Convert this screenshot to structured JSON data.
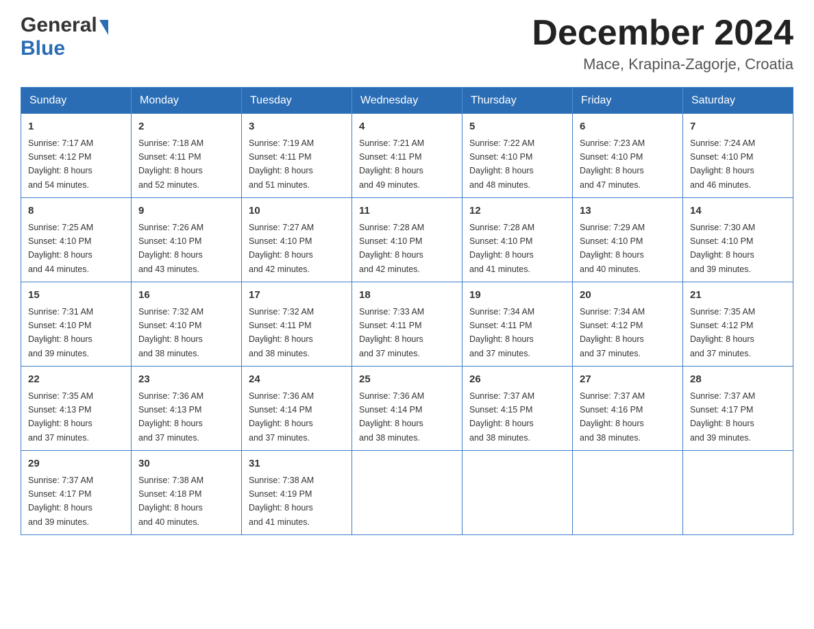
{
  "header": {
    "logo_general": "General",
    "logo_blue": "Blue",
    "main_title": "December 2024",
    "subtitle": "Mace, Krapina-Zagorje, Croatia"
  },
  "calendar": {
    "days_of_week": [
      "Sunday",
      "Monday",
      "Tuesday",
      "Wednesday",
      "Thursday",
      "Friday",
      "Saturday"
    ],
    "weeks": [
      [
        {
          "day": "1",
          "sunrise": "Sunrise: 7:17 AM",
          "sunset": "Sunset: 4:12 PM",
          "daylight": "Daylight: 8 hours",
          "minutes": "and 54 minutes."
        },
        {
          "day": "2",
          "sunrise": "Sunrise: 7:18 AM",
          "sunset": "Sunset: 4:11 PM",
          "daylight": "Daylight: 8 hours",
          "minutes": "and 52 minutes."
        },
        {
          "day": "3",
          "sunrise": "Sunrise: 7:19 AM",
          "sunset": "Sunset: 4:11 PM",
          "daylight": "Daylight: 8 hours",
          "minutes": "and 51 minutes."
        },
        {
          "day": "4",
          "sunrise": "Sunrise: 7:21 AM",
          "sunset": "Sunset: 4:11 PM",
          "daylight": "Daylight: 8 hours",
          "minutes": "and 49 minutes."
        },
        {
          "day": "5",
          "sunrise": "Sunrise: 7:22 AM",
          "sunset": "Sunset: 4:10 PM",
          "daylight": "Daylight: 8 hours",
          "minutes": "and 48 minutes."
        },
        {
          "day": "6",
          "sunrise": "Sunrise: 7:23 AM",
          "sunset": "Sunset: 4:10 PM",
          "daylight": "Daylight: 8 hours",
          "minutes": "and 47 minutes."
        },
        {
          "day": "7",
          "sunrise": "Sunrise: 7:24 AM",
          "sunset": "Sunset: 4:10 PM",
          "daylight": "Daylight: 8 hours",
          "minutes": "and 46 minutes."
        }
      ],
      [
        {
          "day": "8",
          "sunrise": "Sunrise: 7:25 AM",
          "sunset": "Sunset: 4:10 PM",
          "daylight": "Daylight: 8 hours",
          "minutes": "and 44 minutes."
        },
        {
          "day": "9",
          "sunrise": "Sunrise: 7:26 AM",
          "sunset": "Sunset: 4:10 PM",
          "daylight": "Daylight: 8 hours",
          "minutes": "and 43 minutes."
        },
        {
          "day": "10",
          "sunrise": "Sunrise: 7:27 AM",
          "sunset": "Sunset: 4:10 PM",
          "daylight": "Daylight: 8 hours",
          "minutes": "and 42 minutes."
        },
        {
          "day": "11",
          "sunrise": "Sunrise: 7:28 AM",
          "sunset": "Sunset: 4:10 PM",
          "daylight": "Daylight: 8 hours",
          "minutes": "and 42 minutes."
        },
        {
          "day": "12",
          "sunrise": "Sunrise: 7:28 AM",
          "sunset": "Sunset: 4:10 PM",
          "daylight": "Daylight: 8 hours",
          "minutes": "and 41 minutes."
        },
        {
          "day": "13",
          "sunrise": "Sunrise: 7:29 AM",
          "sunset": "Sunset: 4:10 PM",
          "daylight": "Daylight: 8 hours",
          "minutes": "and 40 minutes."
        },
        {
          "day": "14",
          "sunrise": "Sunrise: 7:30 AM",
          "sunset": "Sunset: 4:10 PM",
          "daylight": "Daylight: 8 hours",
          "minutes": "and 39 minutes."
        }
      ],
      [
        {
          "day": "15",
          "sunrise": "Sunrise: 7:31 AM",
          "sunset": "Sunset: 4:10 PM",
          "daylight": "Daylight: 8 hours",
          "minutes": "and 39 minutes."
        },
        {
          "day": "16",
          "sunrise": "Sunrise: 7:32 AM",
          "sunset": "Sunset: 4:10 PM",
          "daylight": "Daylight: 8 hours",
          "minutes": "and 38 minutes."
        },
        {
          "day": "17",
          "sunrise": "Sunrise: 7:32 AM",
          "sunset": "Sunset: 4:11 PM",
          "daylight": "Daylight: 8 hours",
          "minutes": "and 38 minutes."
        },
        {
          "day": "18",
          "sunrise": "Sunrise: 7:33 AM",
          "sunset": "Sunset: 4:11 PM",
          "daylight": "Daylight: 8 hours",
          "minutes": "and 37 minutes."
        },
        {
          "day": "19",
          "sunrise": "Sunrise: 7:34 AM",
          "sunset": "Sunset: 4:11 PM",
          "daylight": "Daylight: 8 hours",
          "minutes": "and 37 minutes."
        },
        {
          "day": "20",
          "sunrise": "Sunrise: 7:34 AM",
          "sunset": "Sunset: 4:12 PM",
          "daylight": "Daylight: 8 hours",
          "minutes": "and 37 minutes."
        },
        {
          "day": "21",
          "sunrise": "Sunrise: 7:35 AM",
          "sunset": "Sunset: 4:12 PM",
          "daylight": "Daylight: 8 hours",
          "minutes": "and 37 minutes."
        }
      ],
      [
        {
          "day": "22",
          "sunrise": "Sunrise: 7:35 AM",
          "sunset": "Sunset: 4:13 PM",
          "daylight": "Daylight: 8 hours",
          "minutes": "and 37 minutes."
        },
        {
          "day": "23",
          "sunrise": "Sunrise: 7:36 AM",
          "sunset": "Sunset: 4:13 PM",
          "daylight": "Daylight: 8 hours",
          "minutes": "and 37 minutes."
        },
        {
          "day": "24",
          "sunrise": "Sunrise: 7:36 AM",
          "sunset": "Sunset: 4:14 PM",
          "daylight": "Daylight: 8 hours",
          "minutes": "and 37 minutes."
        },
        {
          "day": "25",
          "sunrise": "Sunrise: 7:36 AM",
          "sunset": "Sunset: 4:14 PM",
          "daylight": "Daylight: 8 hours",
          "minutes": "and 38 minutes."
        },
        {
          "day": "26",
          "sunrise": "Sunrise: 7:37 AM",
          "sunset": "Sunset: 4:15 PM",
          "daylight": "Daylight: 8 hours",
          "minutes": "and 38 minutes."
        },
        {
          "day": "27",
          "sunrise": "Sunrise: 7:37 AM",
          "sunset": "Sunset: 4:16 PM",
          "daylight": "Daylight: 8 hours",
          "minutes": "and 38 minutes."
        },
        {
          "day": "28",
          "sunrise": "Sunrise: 7:37 AM",
          "sunset": "Sunset: 4:17 PM",
          "daylight": "Daylight: 8 hours",
          "minutes": "and 39 minutes."
        }
      ],
      [
        {
          "day": "29",
          "sunrise": "Sunrise: 7:37 AM",
          "sunset": "Sunset: 4:17 PM",
          "daylight": "Daylight: 8 hours",
          "minutes": "and 39 minutes."
        },
        {
          "day": "30",
          "sunrise": "Sunrise: 7:38 AM",
          "sunset": "Sunset: 4:18 PM",
          "daylight": "Daylight: 8 hours",
          "minutes": "and 40 minutes."
        },
        {
          "day": "31",
          "sunrise": "Sunrise: 7:38 AM",
          "sunset": "Sunset: 4:19 PM",
          "daylight": "Daylight: 8 hours",
          "minutes": "and 41 minutes."
        },
        null,
        null,
        null,
        null
      ]
    ]
  }
}
